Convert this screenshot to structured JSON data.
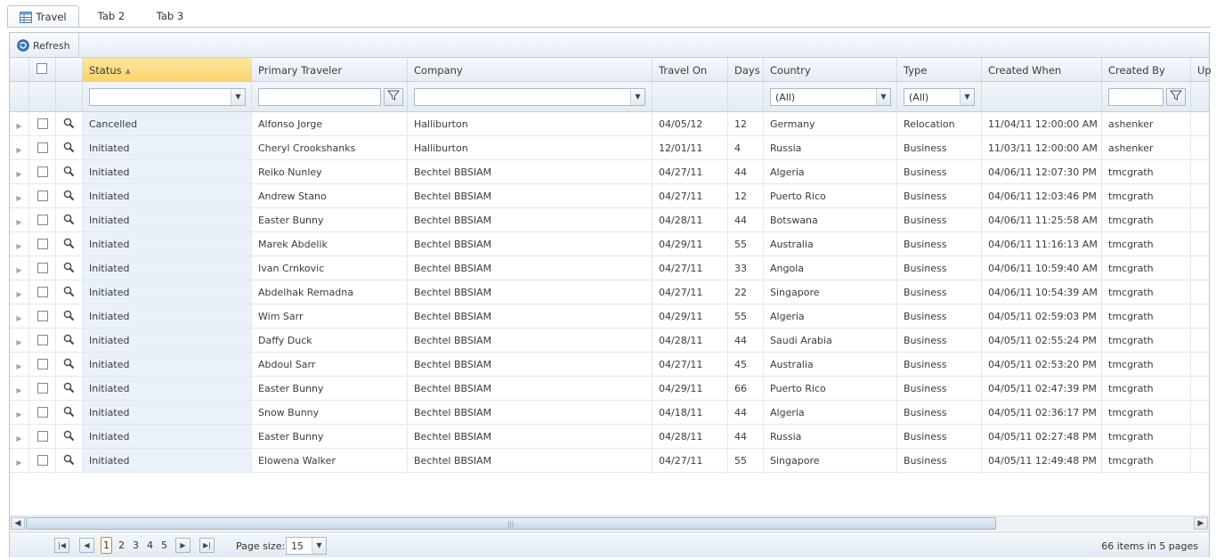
{
  "tabs": [
    {
      "label": "Travel",
      "icon": "grid-icon"
    },
    {
      "label": "Tab 2"
    },
    {
      "label": "Tab 3"
    }
  ],
  "toolbar": {
    "refresh_label": "Refresh"
  },
  "columns": {
    "status": "Status",
    "primary_traveler": "Primary Traveler",
    "company": "Company",
    "travel_on": "Travel On",
    "days": "Days",
    "country": "Country",
    "type": "Type",
    "created_when": "Created When",
    "created_by": "Created By",
    "updated": "Up"
  },
  "filters": {
    "country": "(All)",
    "type": "(All)"
  },
  "rows": [
    {
      "status": "Cancelled",
      "traveler": "Alfonso Jorge",
      "company": "Halliburton",
      "travel_on": "04/05/12",
      "days": "12",
      "country": "Germany",
      "type": "Relocation",
      "created_when": "11/04/11 12:00:00 AM",
      "created_by": "ashenker"
    },
    {
      "status": "Initiated",
      "traveler": "Cheryl Crookshanks",
      "company": "Halliburton",
      "travel_on": "12/01/11",
      "days": "4",
      "country": "Russia",
      "type": "Business",
      "created_when": "11/03/11 12:00:00 AM",
      "created_by": "ashenker"
    },
    {
      "status": "Initiated",
      "traveler": "Reiko Nunley",
      "company": "Bechtel BBSIAM",
      "travel_on": "04/27/11",
      "days": "44",
      "country": "Algeria",
      "type": "Business",
      "created_when": "04/06/11 12:07:30 PM",
      "created_by": "tmcgrath"
    },
    {
      "status": "Initiated",
      "traveler": "Andrew Stano",
      "company": "Bechtel BBSIAM",
      "travel_on": "04/27/11",
      "days": "12",
      "country": "Puerto Rico",
      "type": "Business",
      "created_when": "04/06/11 12:03:46 PM",
      "created_by": "tmcgrath"
    },
    {
      "status": "Initiated",
      "traveler": "Easter Bunny",
      "company": "Bechtel BBSIAM",
      "travel_on": "04/28/11",
      "days": "44",
      "country": "Botswana",
      "type": "Business",
      "created_when": "04/06/11 11:25:58 AM",
      "created_by": "tmcgrath"
    },
    {
      "status": "Initiated",
      "traveler": "Marek Abdelik",
      "company": "Bechtel BBSIAM",
      "travel_on": "04/29/11",
      "days": "55",
      "country": "Australia",
      "type": "Business",
      "created_when": "04/06/11 11:16:13 AM",
      "created_by": "tmcgrath"
    },
    {
      "status": "Initiated",
      "traveler": "Ivan Crnkovic",
      "company": "Bechtel BBSIAM",
      "travel_on": "04/27/11",
      "days": "33",
      "country": "Angola",
      "type": "Business",
      "created_when": "04/06/11 10:59:40 AM",
      "created_by": "tmcgrath"
    },
    {
      "status": "Initiated",
      "traveler": "Abdelhak Remadna",
      "company": "Bechtel BBSIAM",
      "travel_on": "04/27/11",
      "days": "22",
      "country": "Singapore",
      "type": "Business",
      "created_when": "04/06/11 10:54:39 AM",
      "created_by": "tmcgrath"
    },
    {
      "status": "Initiated",
      "traveler": "Wim Sarr",
      "company": "Bechtel BBSIAM",
      "travel_on": "04/29/11",
      "days": "55",
      "country": "Algeria",
      "type": "Business",
      "created_when": "04/05/11 02:59:03 PM",
      "created_by": "tmcgrath"
    },
    {
      "status": "Initiated",
      "traveler": "Daffy Duck",
      "company": "Bechtel BBSIAM",
      "travel_on": "04/28/11",
      "days": "44",
      "country": "Saudi Arabia",
      "type": "Business",
      "created_when": "04/05/11 02:55:24 PM",
      "created_by": "tmcgrath"
    },
    {
      "status": "Initiated",
      "traveler": "Abdoul Sarr",
      "company": "Bechtel BBSIAM",
      "travel_on": "04/27/11",
      "days": "45",
      "country": "Australia",
      "type": "Business",
      "created_when": "04/05/11 02:53:20 PM",
      "created_by": "tmcgrath"
    },
    {
      "status": "Initiated",
      "traveler": "Easter Bunny",
      "company": "Bechtel BBSIAM",
      "travel_on": "04/29/11",
      "days": "66",
      "country": "Puerto Rico",
      "type": "Business",
      "created_when": "04/05/11 02:47:39 PM",
      "created_by": "tmcgrath"
    },
    {
      "status": "Initiated",
      "traveler": "Snow Bunny",
      "company": "Bechtel BBSIAM",
      "travel_on": "04/18/11",
      "days": "44",
      "country": "Algeria",
      "type": "Business",
      "created_when": "04/05/11 02:36:17 PM",
      "created_by": "tmcgrath"
    },
    {
      "status": "Initiated",
      "traveler": "Easter Bunny",
      "company": "Bechtel BBSIAM",
      "travel_on": "04/28/11",
      "days": "44",
      "country": "Russia",
      "type": "Business",
      "created_when": "04/05/11 02:27:48 PM",
      "created_by": "tmcgrath"
    },
    {
      "status": "Initiated",
      "traveler": "Elowena Walker",
      "company": "Bechtel BBSIAM",
      "travel_on": "04/27/11",
      "days": "55",
      "country": "Singapore",
      "type": "Business",
      "created_when": "04/05/11 12:49:48 PM",
      "created_by": "tmcgrath"
    }
  ],
  "pager": {
    "pages": [
      "1",
      "2",
      "3",
      "4",
      "5"
    ],
    "current_page": "1",
    "page_size_label": "Page size:",
    "page_size": "15",
    "info": "66 items in 5 pages"
  },
  "colors": {
    "accent": "#fbd46c",
    "border": "#b6c7d6",
    "current_page_border": "#e2832f"
  }
}
